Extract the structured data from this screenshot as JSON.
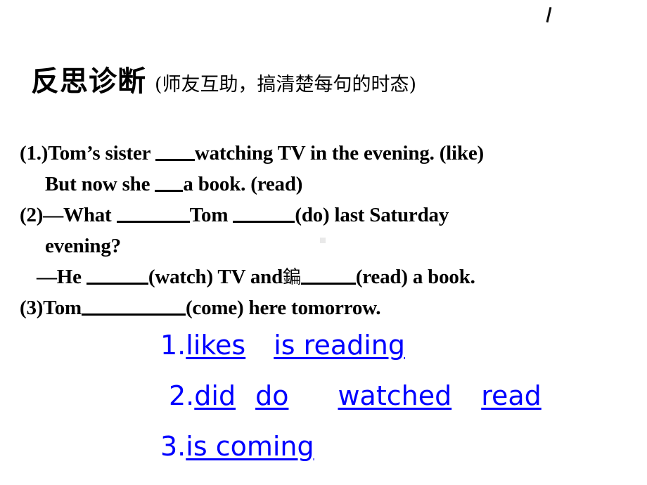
{
  "slide": {
    "heading": {
      "main": "反思诊断",
      "sub": "(师友互助，搞清楚每句的时态)"
    },
    "questions": [
      {
        "id": "q1-line1",
        "number": "(1.)",
        "segments": [
          "Tom’s sister ",
          "watching TV in the evening. (like)"
        ]
      },
      {
        "id": "q1-line2",
        "segments": [
          "But now she ",
          "a book. (read)"
        ]
      },
      {
        "id": "q2-line1",
        "number": "(2)",
        "segments": [
          "—What ",
          "Tom ",
          "(do) last Saturday"
        ]
      },
      {
        "id": "q2-line2",
        "segments": [
          "evening?"
        ]
      },
      {
        "id": "q2-line3",
        "segments": [
          "—He ",
          "(watch) TV and",
          "鍽",
          "(read) a book."
        ]
      },
      {
        "id": "q3-line1",
        "number": "(3)",
        "segments": [
          "Tom",
          "(come) here  tomorrow."
        ]
      }
    ],
    "answers": [
      {
        "number": "1.",
        "words": [
          "likes",
          "is reading"
        ]
      },
      {
        "number": "2.",
        "words": [
          "did",
          "do",
          "watched",
          "read"
        ]
      },
      {
        "number": "3.",
        "words": [
          "is coming"
        ]
      }
    ],
    "colors": {
      "answer_text": "#0000FF",
      "question_text": "#000000",
      "background": "#FFFFFF"
    }
  }
}
